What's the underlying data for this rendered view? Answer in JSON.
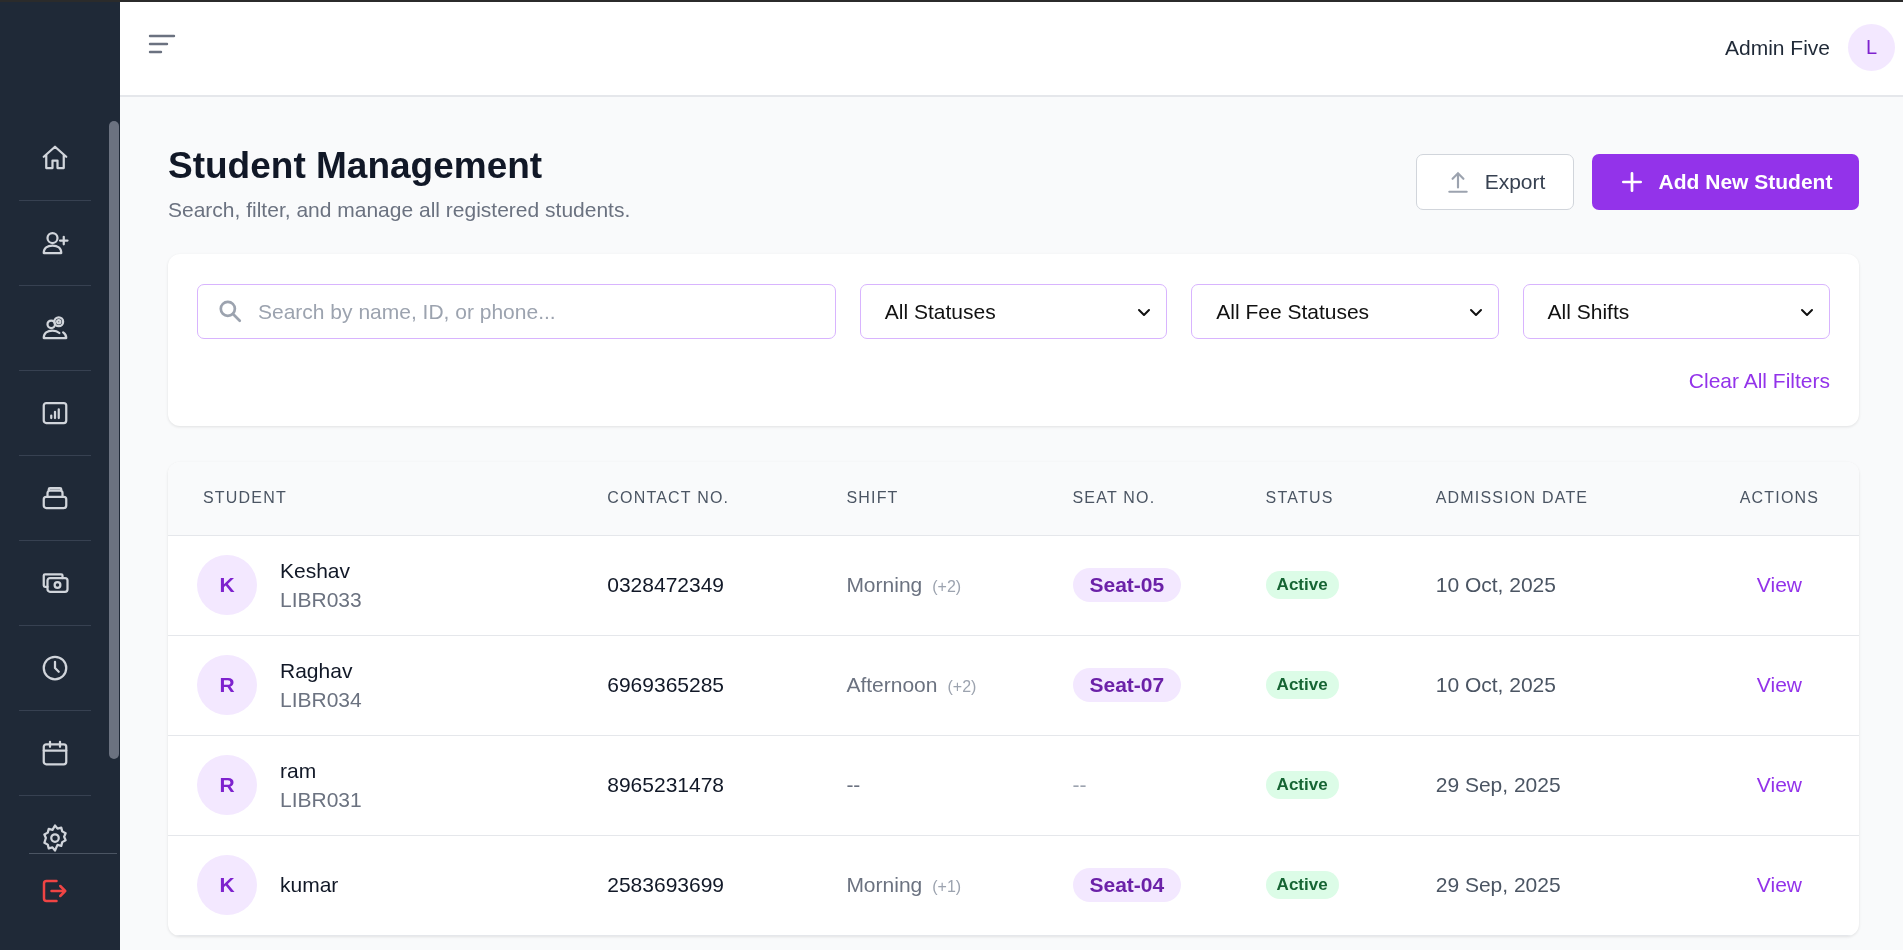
{
  "header": {
    "user_name": "Admin Five",
    "avatar_initial": "L"
  },
  "page": {
    "title": "Student Management",
    "subtitle": "Search, filter, and manage all registered students.",
    "export_button": "Export",
    "add_button": "Add New Student"
  },
  "filters": {
    "search": {
      "placeholder": "Search by name, ID, or phone..."
    },
    "dropdowns": [
      {
        "value": "All Statuses"
      },
      {
        "value": "All Fee Statuses"
      },
      {
        "value": "All Shifts"
      }
    ],
    "clear_link": "Clear All Filters"
  },
  "table": {
    "columns": [
      "STUDENT",
      "CONTACT NO.",
      "SHIFT",
      "SEAT NO.",
      "STATUS",
      "ADMISSION DATE",
      "ACTIONS"
    ],
    "rows": [
      {
        "initial": "K",
        "name": "Keshav",
        "id": "LIBR033",
        "contact": "0328472349",
        "shift": "Morning",
        "shift_extra": "(+2)",
        "seat": {
          "kind": "pill",
          "text": "Seat-05"
        },
        "status": "Active",
        "admission_date": "10 Oct, 2025",
        "action": "View"
      },
      {
        "initial": "R",
        "name": "Raghav",
        "id": "LIBR034",
        "contact": "6969365285",
        "shift": "Afternoon",
        "shift_extra": "(+2)",
        "seat": {
          "kind": "pill",
          "text": "Seat-07"
        },
        "status": "Active",
        "admission_date": "10 Oct, 2025",
        "action": "View"
      },
      {
        "initial": "R",
        "name": "ram",
        "id": "LIBR031",
        "contact": "8965231478",
        "shift": "--",
        "seat": {
          "kind": "empty",
          "text": "--"
        },
        "status": "Active",
        "admission_date": "29 Sep, 2025",
        "action": "View"
      },
      {
        "initial": "K",
        "name": "kumar",
        "contact": "2583693699",
        "shift": "Morning",
        "shift_extra": "(+1)",
        "seat": {
          "kind": "pill",
          "text": "Seat-04"
        },
        "status": "Active",
        "admission_date": "29 Sep, 2025",
        "action": "View"
      }
    ]
  }
}
